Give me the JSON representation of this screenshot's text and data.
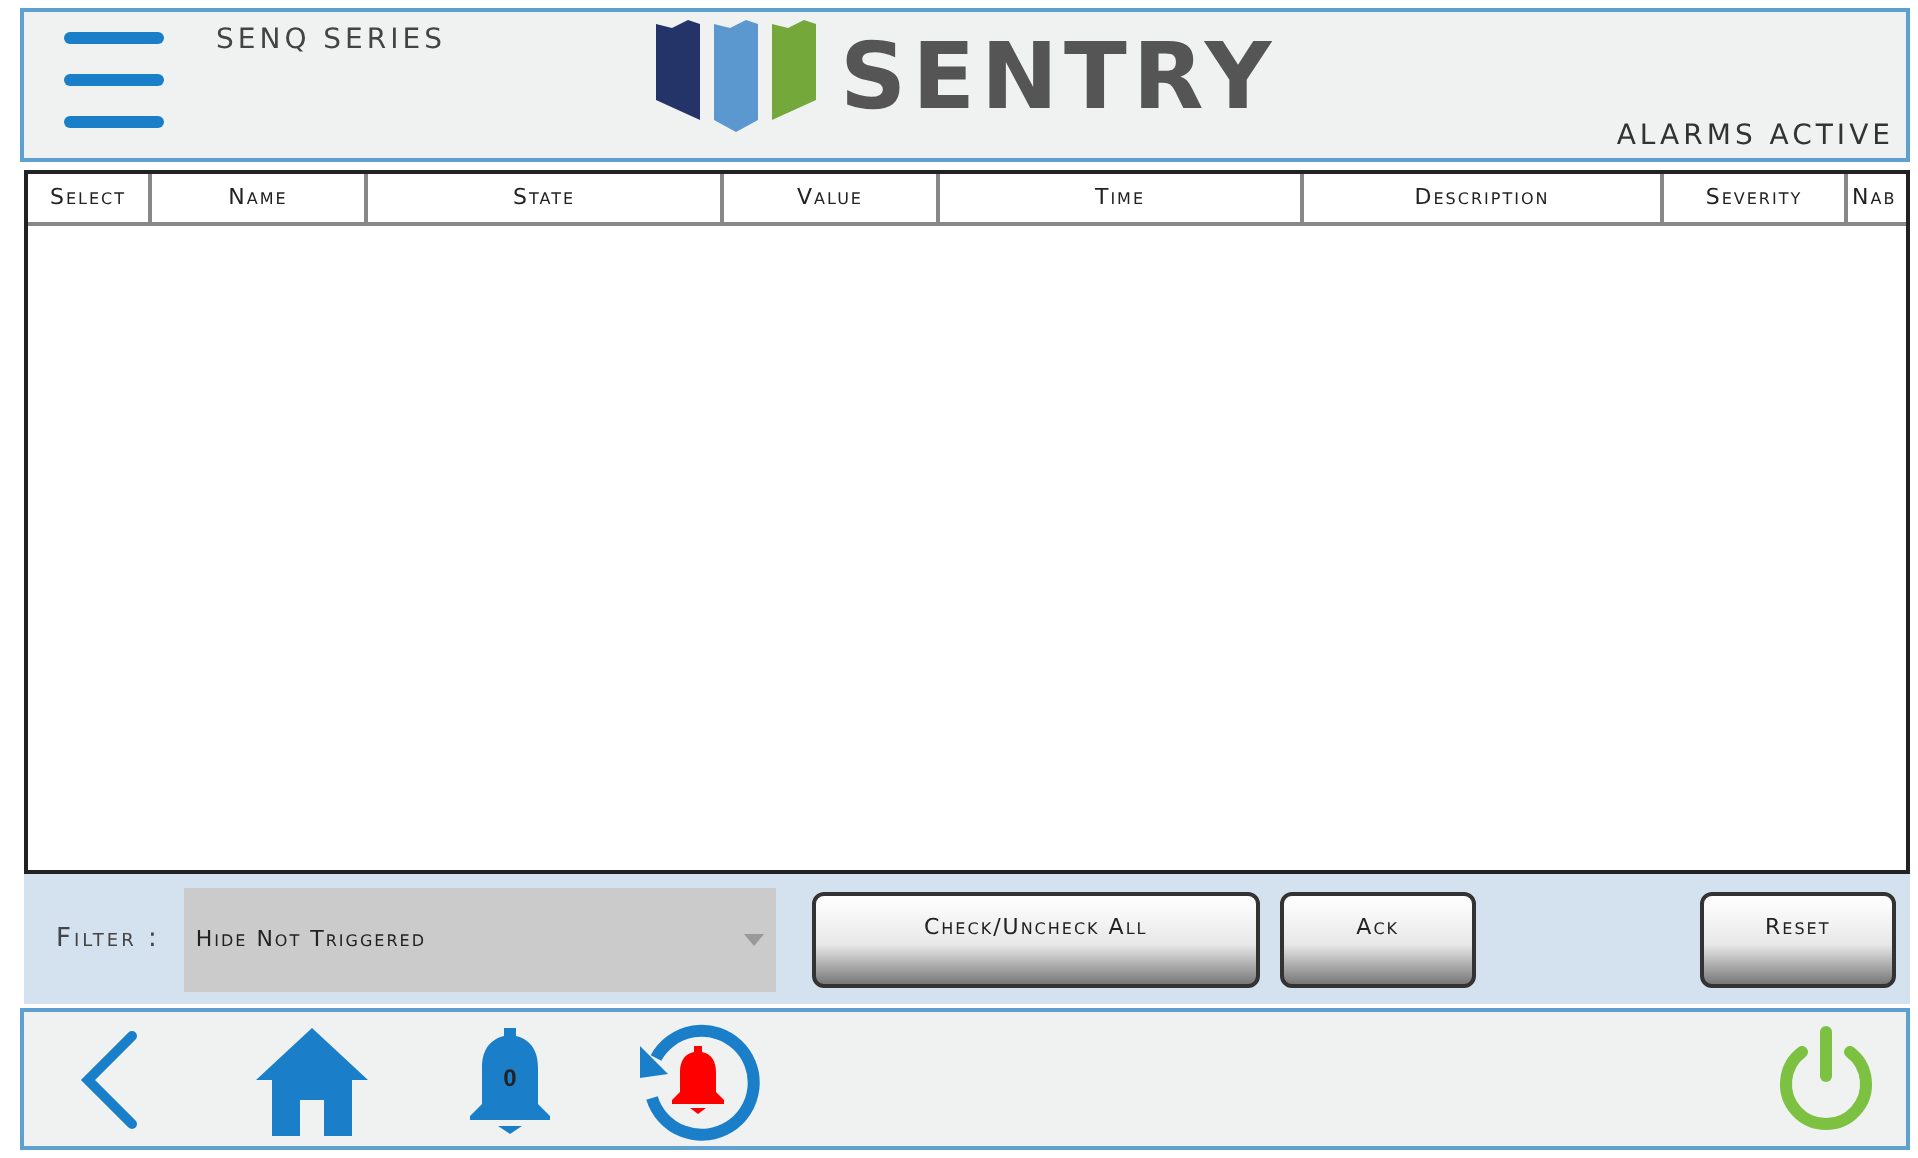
{
  "header": {
    "series": "SENQ SERIES",
    "logo": "SENTRY",
    "status": "ALARMS ACTIVE"
  },
  "table": {
    "columns": [
      "Select",
      "Name",
      "State",
      "Value",
      "Time",
      "Description",
      "Severity",
      "Nab"
    ]
  },
  "filter": {
    "label": "Filter :",
    "value": "Hide Not Triggered"
  },
  "buttons": [
    "Check/Uncheck All",
    "Ack",
    "Reset"
  ],
  "nav": {
    "alarm_count": "0"
  }
}
